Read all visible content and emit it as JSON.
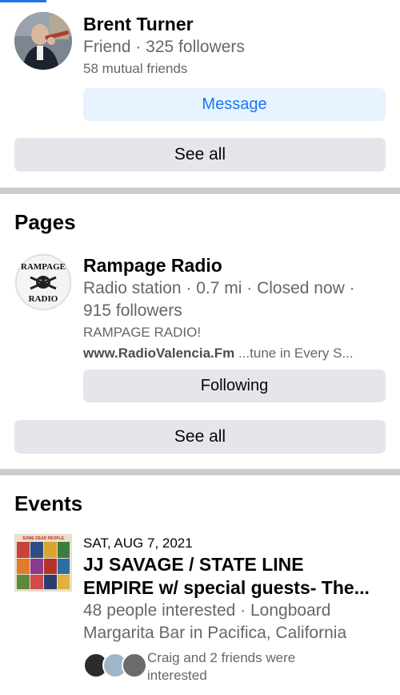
{
  "friend": {
    "name": "Brent Turner",
    "meta": "Friend · 325 followers",
    "mutual": "58 mutual friends",
    "message_label": "Message"
  },
  "friends_section": {
    "see_all": "See all"
  },
  "pages": {
    "title": "Pages",
    "item": {
      "name": "Rampage Radio",
      "meta_line1": "Radio station · 0.7 mi · Closed now ·",
      "meta_line2": "915 followers",
      "desc_line1": "RAMPAGE RADIO!",
      "desc_link": "www.RadioValencia.Fm",
      "desc_rest": "  ...tune in Every S...",
      "logo_text_top": "RAMPAGE",
      "logo_text_bottom": "RADIO",
      "following_label": "Following"
    },
    "see_all": "See all"
  },
  "events": {
    "title": "Events",
    "item": {
      "date": "SAT, AUG 7, 2021",
      "title_line1": "JJ SAVAGE / STATE LINE",
      "title_line2": "EMPIRE w/ special guests- The...",
      "meta_line1": "48 people interested · Longboard",
      "meta_line2": "Margarita Bar in Pacifica, California",
      "friends_line1": "Craig and 2 friends were",
      "friends_line2": "interested",
      "thumb_caption": "SOME DEAD PEOPLE"
    }
  },
  "colors": {
    "accent": "#1877f2",
    "message_bg": "#e7f3ff",
    "button_bg": "#e4e6eb",
    "divider": "#c9ccd1",
    "secondary_text": "#65676b"
  }
}
